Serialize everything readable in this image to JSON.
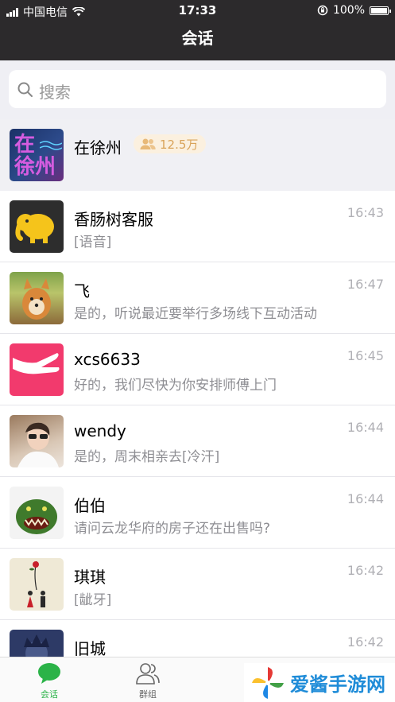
{
  "status_bar": {
    "carrier": "中国电信",
    "time": "17:33",
    "battery": "100%",
    "battery_level": 1.0
  },
  "header": {
    "title": "会话"
  },
  "search": {
    "placeholder": "搜索"
  },
  "group": {
    "name": "在徐州",
    "member_count": "12.5万",
    "avatar_text": [
      "在",
      "徐州"
    ]
  },
  "conversations": [
    {
      "name": "香肠树客服",
      "message": "[语音]",
      "time": "16:43",
      "avatar": "elephant-logo"
    },
    {
      "name": "飞",
      "message": "是的，听说最近要举行多场线下互动活动",
      "time": "16:47",
      "avatar": "shiba-dog-photo"
    },
    {
      "name": "xcs6633",
      "message": "好的，我们尽快为你安排师傅上门",
      "time": "16:45",
      "avatar": "pink-hand-logo"
    },
    {
      "name": "wendy",
      "message": "是的，周末相亲去[冷汗]",
      "time": "16:44",
      "avatar": "portrait-photo"
    },
    {
      "name": "伯伯",
      "message": "请问云龙华府的房子还在出售吗?",
      "time": "16:44",
      "avatar": "green-monster-photo"
    },
    {
      "name": "琪琪",
      "message": "[龇牙]",
      "time": "16:42",
      "avatar": "couple-illustration"
    },
    {
      "name": "旧城",
      "message": "",
      "time": "16:42",
      "avatar": "dark-avatar"
    }
  ],
  "tabbar": {
    "tabs": [
      {
        "label": "会话",
        "active": true,
        "icon": "chat-bubble-icon"
      },
      {
        "label": "群组",
        "active": false,
        "icon": "group-icon"
      }
    ]
  },
  "watermark": {
    "text": "爱酱手游网"
  },
  "colors": {
    "header_bg": "#2c2a2c",
    "accent": "#2bb348",
    "badge_text": "#d9a35a"
  }
}
